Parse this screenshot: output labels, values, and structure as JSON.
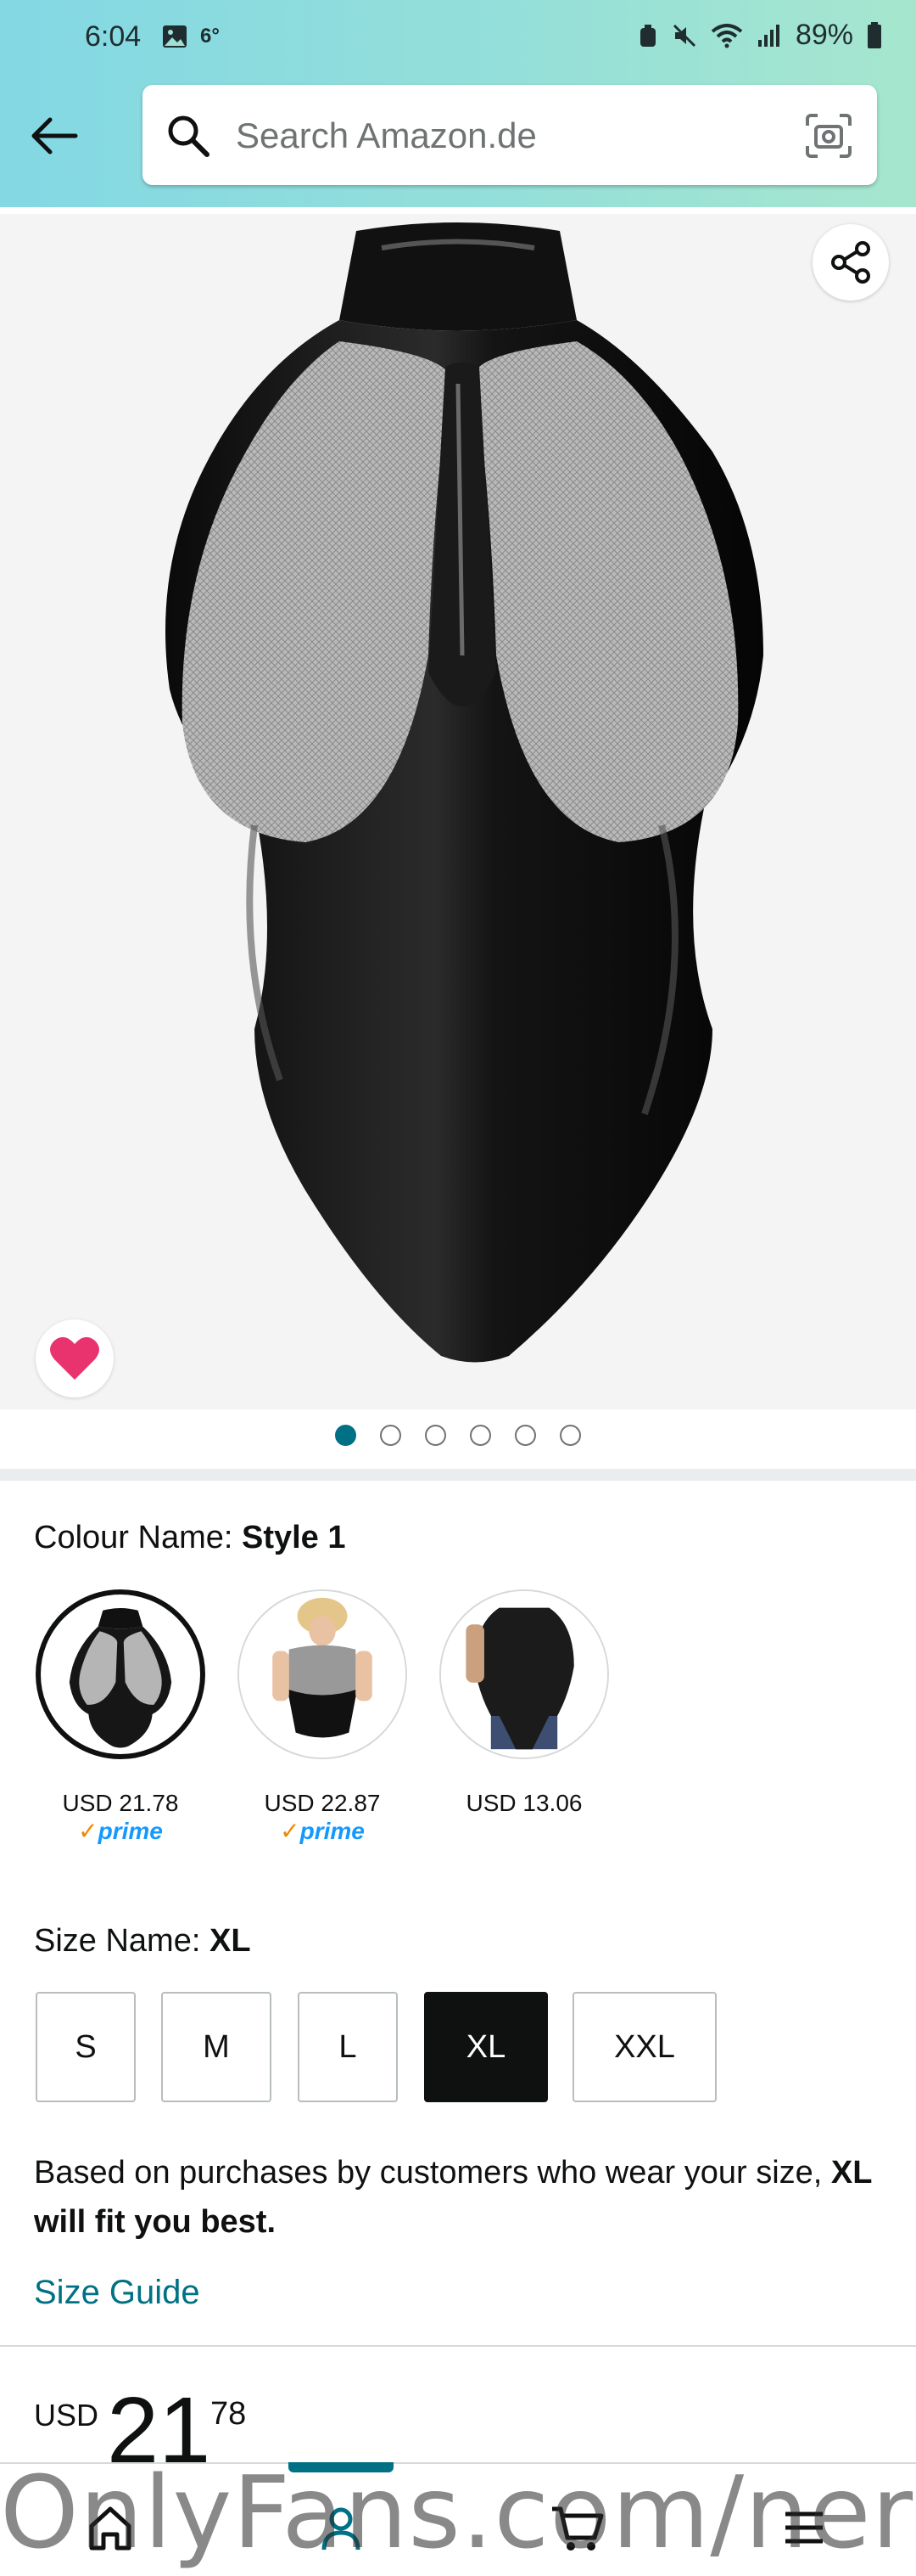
{
  "status_bar": {
    "time": "6:04",
    "temperature": "6°",
    "battery": "89%"
  },
  "search": {
    "placeholder": "Search Amazon.de"
  },
  "carousel": {
    "total": 6,
    "active_index": 0
  },
  "colour": {
    "label": "Colour Name: ",
    "selected_value": "Style 1",
    "options": [
      {
        "price": "USD 21.78",
        "prime": "prime",
        "selected": true
      },
      {
        "price": "USD 22.87",
        "prime": "prime",
        "selected": false
      },
      {
        "price": "USD 13.06",
        "prime": "",
        "selected": false
      }
    ]
  },
  "size": {
    "label": "Size Name: ",
    "selected_value": "XL",
    "options": [
      "S",
      "M",
      "L",
      "XL",
      "XXL"
    ]
  },
  "fit": {
    "prefix": "Based on purchases by customers who wear your size, ",
    "bold": "XL will fit you best."
  },
  "size_guide": "Size Guide",
  "price": {
    "currency": "USD",
    "whole": "21",
    "fraction": "78"
  },
  "watermark": "OnlyFans.com/nerdy",
  "colors": {
    "accent": "#007185",
    "prime_blue": "#1399ff",
    "wishlist_pink": "#e8336e"
  }
}
